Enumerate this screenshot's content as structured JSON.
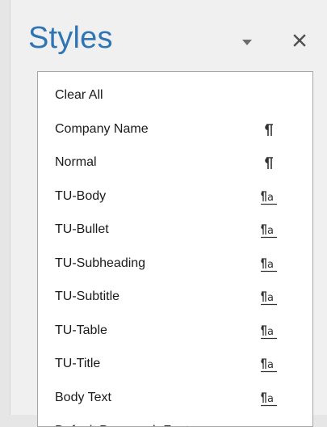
{
  "pane": {
    "title": "Styles",
    "options_icon": "dropdown-triangle-icon",
    "close_icon": "close-icon",
    "title_color": "#2e75b6"
  },
  "styles": [
    {
      "name": "Clear All",
      "icon": null
    },
    {
      "name": "Company Name",
      "icon": "paragraph-style-icon"
    },
    {
      "name": "Normal",
      "icon": "paragraph-style-icon"
    },
    {
      "name": "TU-Body",
      "icon": "linked-style-icon"
    },
    {
      "name": "TU-Bullet",
      "icon": "linked-style-icon"
    },
    {
      "name": "TU-Subheading",
      "icon": "linked-style-icon"
    },
    {
      "name": "TU-Subtitle",
      "icon": "linked-style-icon"
    },
    {
      "name": "TU-Table",
      "icon": "linked-style-icon"
    },
    {
      "name": "TU-Title",
      "icon": "linked-style-icon"
    },
    {
      "name": "Body Text",
      "icon": "linked-style-icon"
    },
    {
      "name": "Default Paragraph Font",
      "icon": "character-style-icon"
    }
  ]
}
